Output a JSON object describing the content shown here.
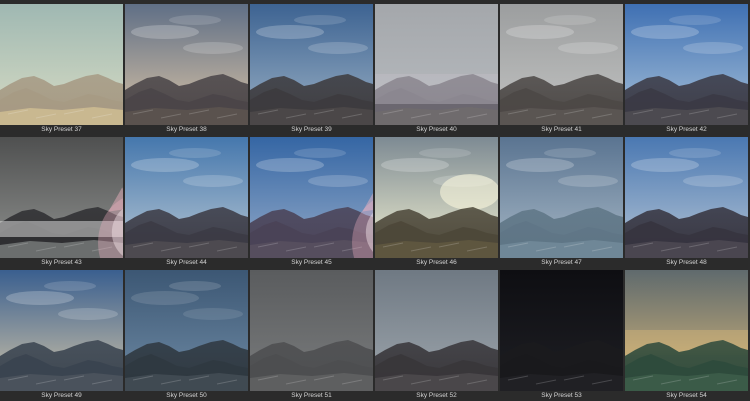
{
  "presets": [
    {
      "label": "Sky Preset 37",
      "sky_top": "#9fb8b2",
      "sky_bottom": "#d8dcc4",
      "mountain": "#a69a84",
      "ground": "#c9b890",
      "variant": "bright"
    },
    {
      "label": "Sky Preset 38",
      "sky_top": "#5f6f86",
      "sky_bottom": "#d9c3a6",
      "mountain": "#4a4548",
      "ground": "#5a524e",
      "variant": "dusk"
    },
    {
      "label": "Sky Preset 39",
      "sky_top": "#3d6392",
      "sky_bottom": "#9ab0c4",
      "mountain": "#3d3b3e",
      "ground": "#4b4748",
      "variant": "blue"
    },
    {
      "label": "Sky Preset 40",
      "sky_top": "#a4a7ab",
      "sky_bottom": "#b8bcc0",
      "mountain": "#6a6770",
      "ground": "#6f6b6d",
      "variant": "haze"
    },
    {
      "label": "Sky Preset 41",
      "sky_top": "#9c9e9f",
      "sky_bottom": "#c2c3c2",
      "mountain": "#4c4846",
      "ground": "#5a5552",
      "variant": "overcast"
    },
    {
      "label": "Sky Preset 42",
      "sky_top": "#3f70b3",
      "sky_bottom": "#a8c2d9",
      "mountain": "#3b3a45",
      "ground": "#4c4a50",
      "variant": "blue"
    },
    {
      "label": "Sky Preset 43",
      "sky_top": "#4f5050",
      "sky_bottom": "#8f918f",
      "mountain": "#2f2f32",
      "ground": "#6b6e6e",
      "variant": "fog"
    },
    {
      "label": "Sky Preset 44",
      "sky_top": "#4577ad",
      "sky_bottom": "#b7c7d3",
      "mountain": "#3c3b45",
      "ground": "#4d4a50",
      "variant": "blue"
    },
    {
      "label": "Sky Preset 45",
      "sky_top": "#3566a4",
      "sky_bottom": "#93aac8",
      "mountain": "#4a4256",
      "ground": "#564e5e",
      "variant": "blue"
    },
    {
      "label": "Sky Preset 46",
      "sky_top": "#7d8a93",
      "sky_bottom": "#efeed0",
      "mountain": "#4c4739",
      "ground": "#5e563f",
      "variant": "sun"
    },
    {
      "label": "Sky Preset 47",
      "sky_top": "#5a7491",
      "sky_bottom": "#a6b7c5",
      "mountain": "#5f7686",
      "ground": "#6f8797",
      "variant": "cold"
    },
    {
      "label": "Sky Preset 48",
      "sky_top": "#4a78b2",
      "sky_bottom": "#b4c4d4",
      "mountain": "#36343f",
      "ground": "#4a4650",
      "variant": "blue"
    },
    {
      "label": "Sky Preset 49",
      "sky_top": "#3a5f8f",
      "sky_bottom": "#d0c4a8",
      "mountain": "#3a4450",
      "ground": "#4a525c",
      "variant": "dusk"
    },
    {
      "label": "Sky Preset 50",
      "sky_top": "#3c5774",
      "sky_bottom": "#6e8aa4",
      "mountain": "#2f3840",
      "ground": "#404a52",
      "variant": "storm"
    },
    {
      "label": "Sky Preset 51",
      "sky_top": "#5a5c5e",
      "sky_bottom": "#7a7c7d",
      "mountain": "#4d4e50",
      "ground": "#5e5f60",
      "variant": "grey"
    },
    {
      "label": "Sky Preset 52",
      "sky_top": "#6f7983",
      "sky_bottom": "#9ea6ad",
      "mountain": "#38363a",
      "ground": "#4a474a",
      "variant": "grey"
    },
    {
      "label": "Sky Preset 53",
      "sky_top": "#0e0e12",
      "sky_bottom": "#1e1f24",
      "mountain": "#1a1a1d",
      "ground": "#202024",
      "variant": "night"
    },
    {
      "label": "Sky Preset 54",
      "sky_top": "#5f6a6d",
      "sky_bottom": "#d7b77a",
      "mountain": "#2e4a3c",
      "ground": "#3b5b48",
      "variant": "golden"
    }
  ],
  "selected_index": -1,
  "overlay_icons": [
    {
      "name": "anime-character-watermark-icon",
      "tile_index": 6
    },
    {
      "name": "anime-character-watermark-icon",
      "tile_index": 8
    }
  ]
}
